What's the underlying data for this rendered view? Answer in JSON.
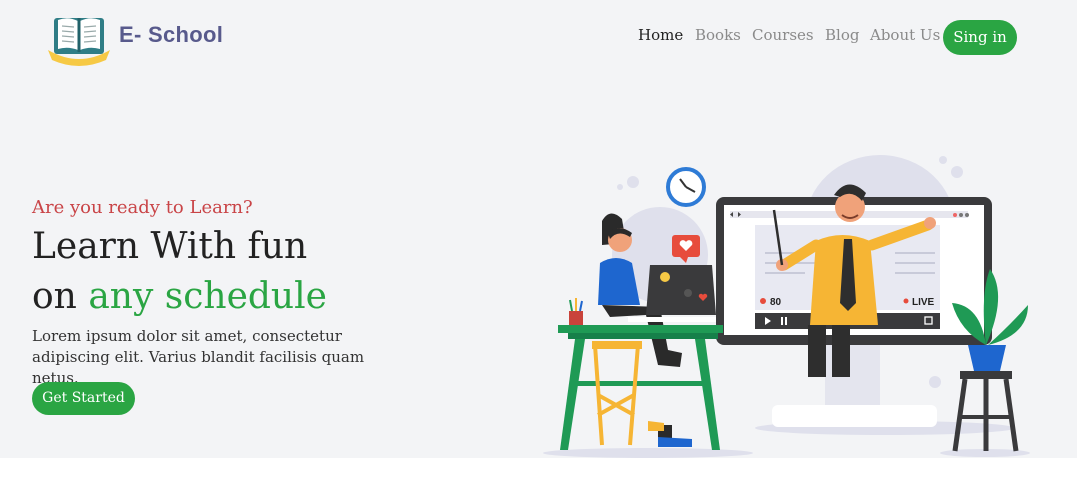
{
  "header": {
    "brand": "E- School",
    "nav": [
      "Home",
      "Books",
      "Courses",
      "Blog",
      "About Us"
    ],
    "signin_label": "Sing in"
  },
  "hero": {
    "tagline": "Are you ready to Learn?",
    "heading_line1": "Learn With fun",
    "heading_line2_prefix": "on ",
    "heading_line2_highlight": "any schedule",
    "description": "Lorem ipsum dolor sit amet, consectetur adipiscing elit. Varius blandit facilisis quam netus.",
    "cta_label": "Get Started"
  },
  "illustration": {
    "viewer_count": "80",
    "live_label": "LIVE"
  },
  "colors": {
    "accent_green": "#2aa543",
    "tagline_red": "#c94447",
    "brand_purple": "#585a8c",
    "hero_background": "#f3f4f6"
  }
}
